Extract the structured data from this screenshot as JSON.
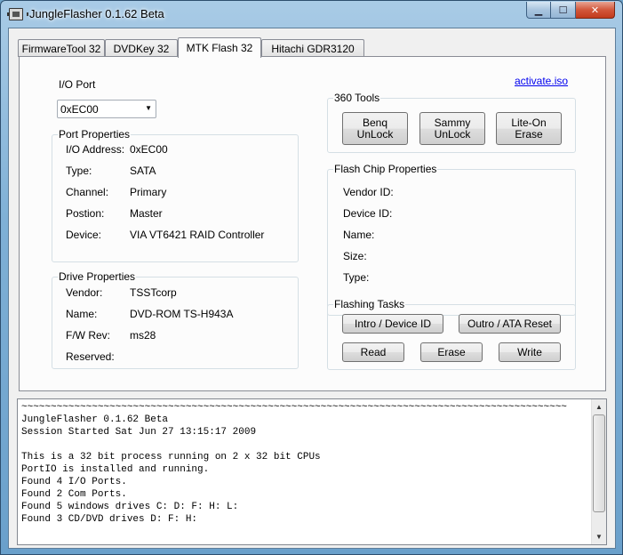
{
  "window": {
    "title": "JungleFlasher 0.1.62 Beta",
    "minimize_glyph": "▁",
    "maximize_glyph": "☐",
    "close_glyph": "✕"
  },
  "tabs": [
    {
      "label": "FirmwareTool 32",
      "active": false
    },
    {
      "label": "DVDKey 32",
      "active": false
    },
    {
      "label": "MTK Flash 32",
      "active": true
    },
    {
      "label": "Hitachi GDR3120",
      "active": false
    }
  ],
  "io_port": {
    "label": "I/O Port",
    "selected": "0xEC00",
    "arrow": "▼"
  },
  "port_properties": {
    "title": "Port Properties",
    "rows": [
      {
        "label": "I/O Address:",
        "value": "0xEC00"
      },
      {
        "label": "Type:",
        "value": "SATA"
      },
      {
        "label": "Channel:",
        "value": "Primary"
      },
      {
        "label": "Postion:",
        "value": "Master"
      },
      {
        "label": "Device:",
        "value": "VIA VT6421 RAID Controller"
      }
    ]
  },
  "drive_properties": {
    "title": "Drive Properties",
    "rows": [
      {
        "label": "Vendor:",
        "value": "TSSTcorp"
      },
      {
        "label": "Name:",
        "value": "DVD-ROM TS-H943A"
      },
      {
        "label": "F/W Rev:",
        "value": "ms28"
      },
      {
        "label": "Reserved:",
        "value": ""
      }
    ]
  },
  "activate_link": "activate.iso",
  "tools_360": {
    "title": "360 Tools",
    "buttons": [
      "Benq\nUnLock",
      "Sammy\nUnLock",
      "Lite-On Erase"
    ]
  },
  "flash_chip": {
    "title": "Flash Chip Properties",
    "rows": [
      "Vendor ID:",
      "Device ID:",
      "Name:",
      "Size:",
      "Type:"
    ]
  },
  "flashing_tasks": {
    "title": "Flashing Tasks",
    "intro": "Intro / Device ID",
    "outro": "Outro / ATA Reset",
    "read": "Read",
    "erase": "Erase",
    "write": "Write"
  },
  "log": {
    "lines": "~~~~~~~~~~~~~~~~~~~~~~~~~~~~~~~~~~~~~~~~~~~~~~~~~~~~~~~~~~~~~~~~~~~~~~~~~~~~~~~~~~~~~~~~~~~~~\nJungleFlasher 0.1.62 Beta\nSession Started Sat Jun 27 13:15:17 2009\n\nThis is a 32 bit process running on 2 x 32 bit CPUs\nPortIO is installed and running.\nFound 4 I/O Ports.\nFound 2 Com Ports.\nFound 5 windows drives C: D: F: H: L:\nFound 3 CD/DVD drives D: F: H:",
    "scroll_up": "▲",
    "scroll_down": "▼"
  }
}
